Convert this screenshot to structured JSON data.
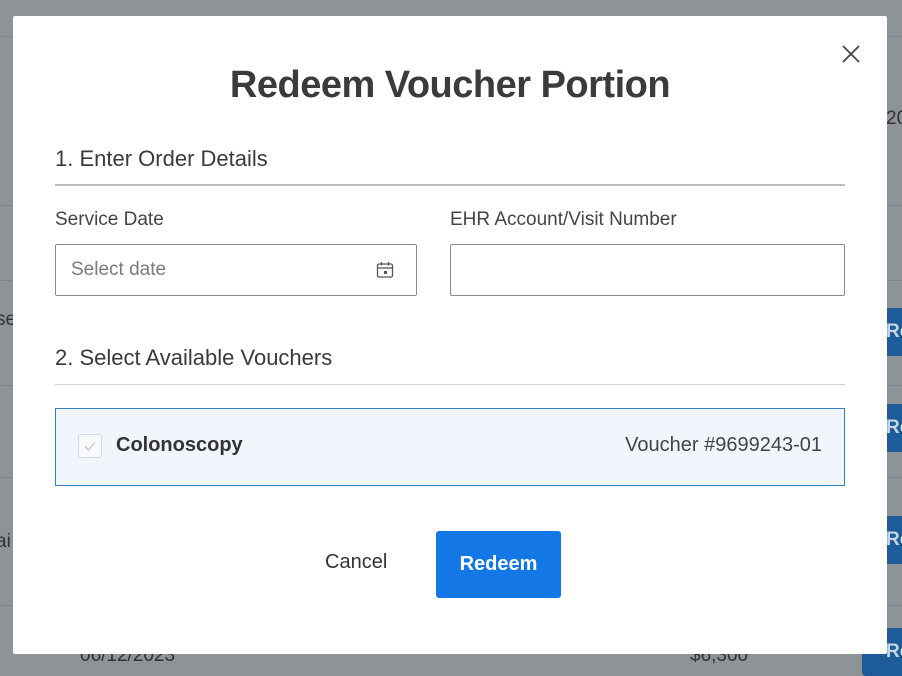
{
  "modal": {
    "title": "Redeem Voucher Portion",
    "section1_title": "1. Enter Order Details",
    "service_date_label": "Service Date",
    "service_date_placeholder": "Select date",
    "ehr_label": "EHR Account/Visit Number",
    "ehr_value": "",
    "section2_title": "2. Select Available Vouchers",
    "voucher": {
      "name": "Colonoscopy",
      "number": "Voucher #9699243-01",
      "checked": true
    },
    "cancel_label": "Cancel",
    "redeem_label": "Redeem"
  },
  "background": {
    "partial_texts": [
      "20",
      "se",
      "ai",
      "06/12/2023",
      "-",
      "-",
      "$6,300"
    ],
    "partial_button_label": "Re"
  },
  "colors": {
    "accent": "#1477e6",
    "overlay": "#8d9397",
    "voucher_bg": "#f0f6fc",
    "voucher_border": "#2f7fc5"
  },
  "icons": [
    "close-icon",
    "calendar-icon",
    "checkmark-icon"
  ]
}
